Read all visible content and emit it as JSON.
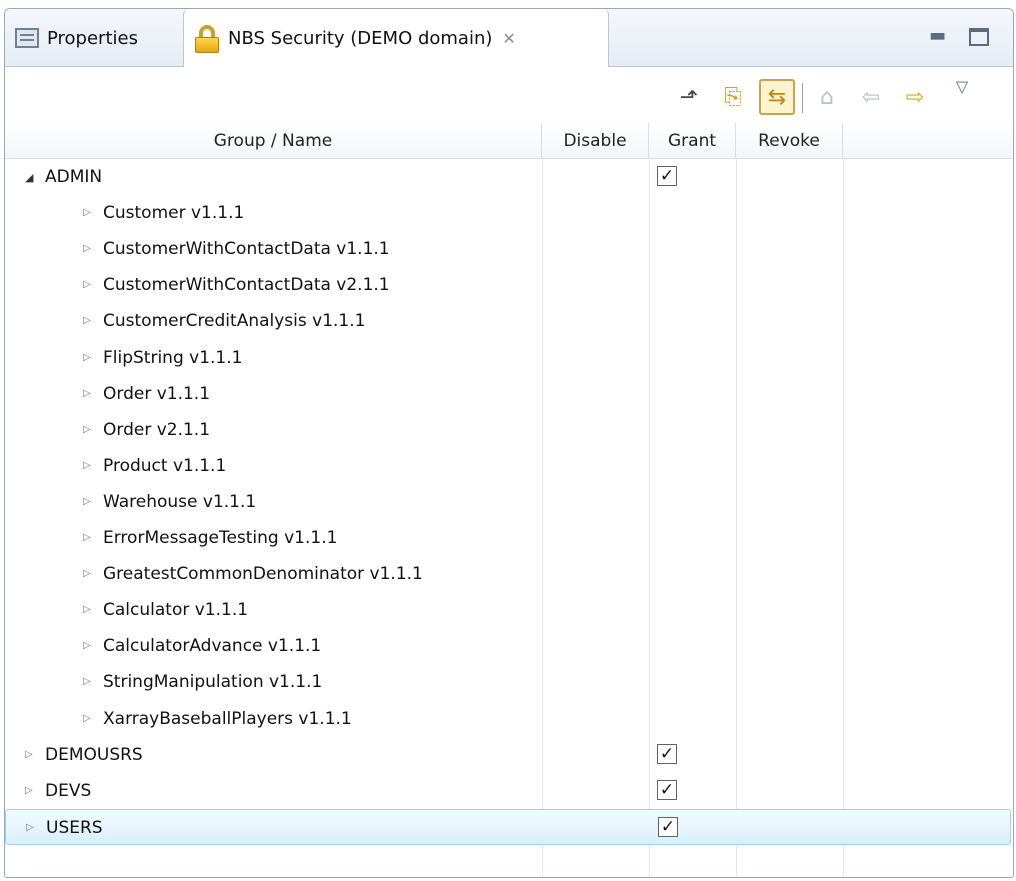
{
  "tabs": {
    "properties_label": "Properties",
    "security_label": "NBS Security (DEMO domain)"
  },
  "table": {
    "columns": [
      "Group / Name",
      "Disable",
      "Grant",
      "Revoke"
    ]
  },
  "rows": [
    {
      "label": "ADMIN",
      "level": 0,
      "expanded": true,
      "grant": true
    },
    {
      "label": "Customer v1.1.1",
      "level": 1,
      "expanded": false,
      "grant": false
    },
    {
      "label": "CustomerWithContactData v1.1.1",
      "level": 1,
      "expanded": false,
      "grant": false
    },
    {
      "label": "CustomerWithContactData v2.1.1",
      "level": 1,
      "expanded": false,
      "grant": false
    },
    {
      "label": "CustomerCreditAnalysis v1.1.1",
      "level": 1,
      "expanded": false,
      "grant": false
    },
    {
      "label": "FlipString v1.1.1",
      "level": 1,
      "expanded": false,
      "grant": false
    },
    {
      "label": "Order v1.1.1",
      "level": 1,
      "expanded": false,
      "grant": false
    },
    {
      "label": "Order v2.1.1",
      "level": 1,
      "expanded": false,
      "grant": false
    },
    {
      "label": "Product v1.1.1",
      "level": 1,
      "expanded": false,
      "grant": false
    },
    {
      "label": "Warehouse v1.1.1",
      "level": 1,
      "expanded": false,
      "grant": false
    },
    {
      "label": "ErrorMessageTesting v1.1.1",
      "level": 1,
      "expanded": false,
      "grant": false
    },
    {
      "label": "GreatestCommonDenominator v1.1.1",
      "level": 1,
      "expanded": false,
      "grant": false
    },
    {
      "label": "Calculator v1.1.1",
      "level": 1,
      "expanded": false,
      "grant": false
    },
    {
      "label": "CalculatorAdvance v1.1.1",
      "level": 1,
      "expanded": false,
      "grant": false
    },
    {
      "label": "StringManipulation v1.1.1",
      "level": 1,
      "expanded": false,
      "grant": false
    },
    {
      "label": "XarrayBaseballPlayers v1.1.1",
      "level": 1,
      "expanded": false,
      "grant": false
    },
    {
      "label": "DEMOUSRS",
      "level": 0,
      "expanded": false,
      "grant": true
    },
    {
      "label": "DEVS",
      "level": 0,
      "expanded": false,
      "grant": true
    },
    {
      "label": "USERS",
      "level": 0,
      "expanded": false,
      "grant": true,
      "selected": true
    }
  ]
}
